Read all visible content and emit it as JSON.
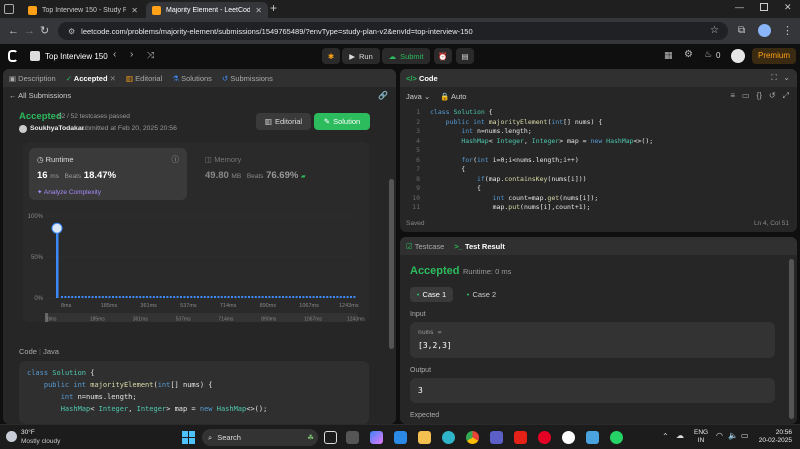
{
  "browser": {
    "tabs": [
      {
        "title": "Top Interview 150 - Study Plan",
        "active": false
      },
      {
        "title": "Majority Element - LeetCode",
        "active": true
      }
    ],
    "url": "leetcode.com/problems/majority-element/submissions/1549765489/?envType=study-plan-v2&envId=top-interview-150"
  },
  "header": {
    "study_plan": "Top Interview 150",
    "run_label": "Run",
    "submit_label": "Submit",
    "streak_count": "0",
    "premium_label": "Premium"
  },
  "left_tabs": [
    {
      "label": "Description"
    },
    {
      "label": "Accepted"
    },
    {
      "label": "Editorial"
    },
    {
      "label": "Solutions"
    },
    {
      "label": "Submissions"
    }
  ],
  "submission": {
    "back_label": "All Submissions",
    "status": "Accepted",
    "testcases": "52 / 52 testcases passed",
    "user": "SoukhyaTodakar",
    "submitted": "submitted at Feb 20, 2025 20:56",
    "editorial_btn": "Editorial",
    "solution_btn": "Solution",
    "runtime_label": "Runtime",
    "runtime_value": "16",
    "runtime_unit": "ms",
    "runtime_beats_label": "Beats",
    "runtime_beats": "18.47%",
    "analyze": "Analyze Complexity",
    "memory_label": "Memory",
    "memory_value": "49.80",
    "memory_unit": "MB",
    "memory_beats_label": "Beats",
    "memory_beats": "76.69%",
    "code_lang_label": "Code",
    "code_lang": "Java"
  },
  "chart_data": {
    "type": "bar",
    "y_ticks": [
      "100%",
      "50%",
      "0%"
    ],
    "x_ticks": [
      "8ms",
      "185ms",
      "361ms",
      "537ms",
      "714ms",
      "890ms",
      "1067ms",
      "1243ms"
    ],
    "minimap_ticks": [
      "8ms",
      "185ms",
      "361ms",
      "537ms",
      "714ms",
      "890ms",
      "1067ms",
      "1243ms"
    ],
    "ylim": [
      0,
      100
    ],
    "highlight_bar": {
      "x": "16ms",
      "value": 90
    },
    "bar_color": "#3d8af7"
  },
  "left_code": [
    "class Solution {",
    "    public int majorityElement(int[] nums) {",
    "        int n=nums.length;",
    "        HashMap< Integer, Integer> map = new HashMap<>();"
  ],
  "editor": {
    "title": "Code",
    "language": "Java",
    "mode": "Auto",
    "saved": "Saved",
    "cursor": "Ln 4, Col 51",
    "lines": [
      "class Solution {",
      "    public int majorityElement(int[] nums) {",
      "        int n=nums.length;",
      "        HashMap< Integer, Integer> map = new HashMap<>();",
      "",
      "        for(int i=0;i<nums.length;i++)",
      "        {",
      "            if(map.containsKey(nums[i]))",
      "            {",
      "                int count=map.get(nums[i]);",
      "                map.put(nums[i],count+1);"
    ]
  },
  "testpanel": {
    "tab_testcase": "Testcase",
    "tab_result": "Test Result",
    "status": "Accepted",
    "runtime": "Runtime: 0 ms",
    "cases": [
      "Case 1",
      "Case 2"
    ],
    "input_label": "Input",
    "var_name": "nums =",
    "input_value": "[3,2,3]",
    "output_label": "Output",
    "output_value": "3",
    "expected_label": "Expected"
  },
  "taskbar": {
    "weather_temp": "30°F",
    "weather_desc": "Mostly cloudy",
    "search_label": "Search",
    "lang": "ENG",
    "region": "IN",
    "time": "20:56",
    "date": "20-02-2025"
  }
}
